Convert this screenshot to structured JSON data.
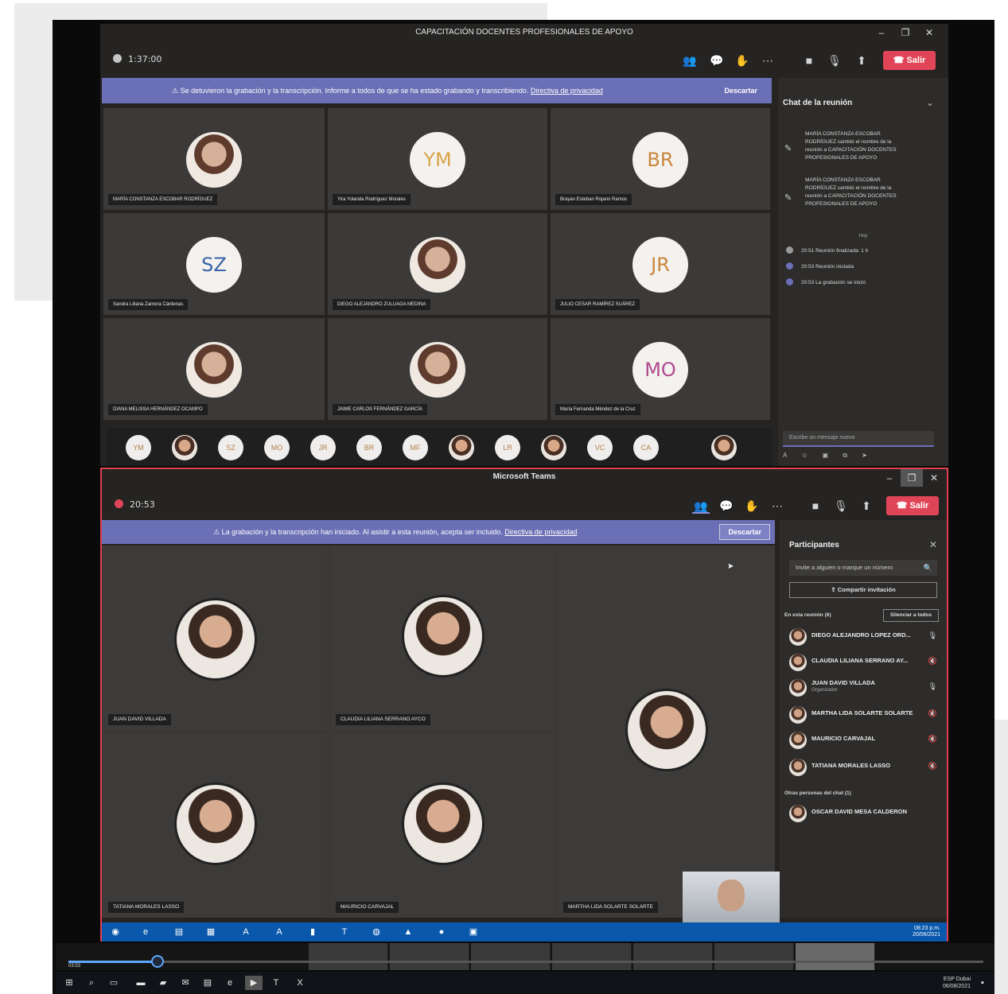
{
  "top_window": {
    "title": "CAPACITACIÓN DOCENTES PROFESIONALES DE APOYO",
    "timer": "1:37:00",
    "leave_label": "Salir",
    "banner_text": "Se detuvieron la grabación y la transcripción. Informe a todos de que se ha estado grabando y transcribiendo.",
    "banner_link": "Directiva de privacidad",
    "banner_button": "Descartar",
    "participants": [
      {
        "name": "MARÍA CONSTANZA ESCOBAR RODRÍGUEZ",
        "initials": "",
        "photo": true,
        "color": ""
      },
      {
        "name": "Yira Yolanda Rodríguez Morales",
        "initials": "YM",
        "photo": false,
        "color": "#d9a54a"
      },
      {
        "name": "Brayan Esteban Rojano Ramos",
        "initials": "BR",
        "photo": false,
        "color": "#c9853b"
      },
      {
        "name": "Sandra Liliana Zamora Cárdenas",
        "initials": "SZ",
        "photo": false,
        "color": "#3b62a8"
      },
      {
        "name": "DIEGO ALEJANDRO ZULUAGA MEDINA",
        "initials": "",
        "photo": true,
        "color": ""
      },
      {
        "name": "JULIO CESAR RAMÍREZ SUÁREZ",
        "initials": "JR",
        "photo": false,
        "color": "#c9853b"
      },
      {
        "name": "DIANA MELISSA HERNÁNDEZ OCAMPO",
        "initials": "",
        "photo": true,
        "color": ""
      },
      {
        "name": "JAIME CARLOS FERNÁNDEZ GARCÍA",
        "initials": "",
        "photo": true,
        "color": ""
      },
      {
        "name": "María Fernanda Méndez de la Cruz",
        "initials": "MO",
        "photo": false,
        "color": "#b04a8e"
      }
    ],
    "chat": {
      "title": "Chat de la reunión",
      "messages": [
        "MARÍA CONSTANZA ESCOBAR RODRÍGUEZ cambió el nombre de la reunión a CAPACITACIÓN DOCENTES PROFESIONALES DE APOYO",
        "MARÍA CONSTANZA ESCOBAR RODRÍGUEZ cambió el nombre de la reunión a CAPACITACIÓN DOCENTES PROFESIONALES DE APOYO"
      ],
      "today": "Hoy",
      "events": [
        "20:51  Reunión finalizada: 1 h",
        "20:53  Reunión iniciada",
        "20:53  La grabación se inició"
      ],
      "input_placeholder": "Escribe un mensaje nuevo",
      "format_icons": "A ☺ ▣ ⧉ ➤"
    },
    "strip_initials": [
      "YM",
      "",
      "SZ",
      "MO",
      "JR",
      "BR",
      "MF",
      "",
      "LR",
      "",
      "VC",
      "CA",
      ""
    ]
  },
  "bottom_window": {
    "title": "Microsoft Teams",
    "timer": "20:53",
    "leave_label": "Salir",
    "banner_text": "La grabación y la transcripción han iniciado. Al asistir a esta reunión, acepta ser incluido.",
    "banner_link": "Directiva de privacidad",
    "banner_button": "Descartar",
    "tiles": [
      {
        "name": "JUAN DAVID VILLADA"
      },
      {
        "name": "CLAUDIA LILIANA SERRANO AYCO"
      },
      {
        "name": "MARTHA LIDA SOLARTE SOLARTE"
      },
      {
        "name": "TATIANA MORALES LASSO"
      },
      {
        "name": "MAURICIO CARVAJAL"
      }
    ],
    "participants_panel": {
      "title": "Participantes",
      "invite_placeholder": "Invite a alguien o marque un número",
      "share_label": "Compartir invitación",
      "in_meeting_label": "En esta reunión (6)",
      "mute_all_label": "Silenciar a todos",
      "people": [
        {
          "name": "DIEGO ALEJANDRO LOPEZ ORD...",
          "sub": ""
        },
        {
          "name": "CLAUDIA LILIANA SERRANO AY...",
          "sub": ""
        },
        {
          "name": "JUAN DAVID VILLADA",
          "sub": "Organizador"
        },
        {
          "name": "MARTHA LIDA SOLARTE SOLARTE",
          "sub": ""
        },
        {
          "name": "MAURICIO CARVAJAL",
          "sub": ""
        },
        {
          "name": "TATIANA MORALES LASSO",
          "sub": ""
        }
      ],
      "others_label": "Otras personas del chat (1)",
      "others": [
        {
          "name": "OSCAR DAVID MESA CALDERON"
        }
      ]
    },
    "taskbar_time": "08:23 p.m.",
    "taskbar_date": "20/06/2021"
  },
  "player": {
    "current_time": "03:53",
    "progress": 0.1
  },
  "win10_taskbar": {
    "time": "Dubai",
    "date": "06/08/2021",
    "lang": "ESP"
  }
}
